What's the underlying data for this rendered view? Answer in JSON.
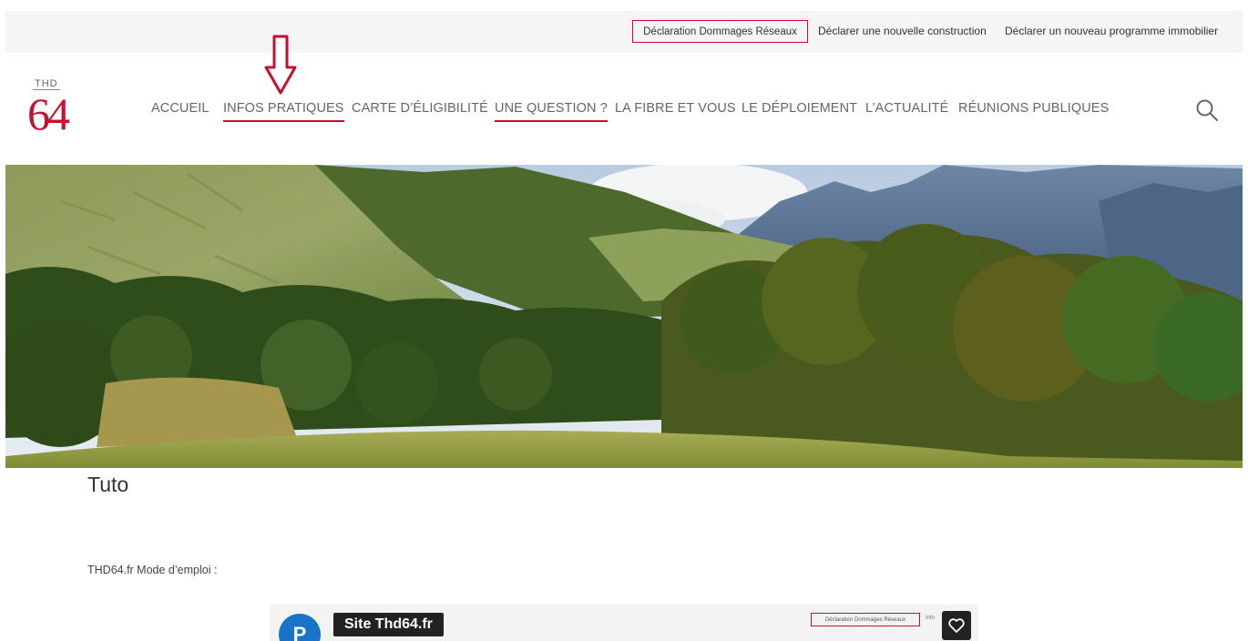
{
  "top_links": {
    "declaration": "Déclaration Dommages Réseaux",
    "construction": "Déclarer une nouvelle construction",
    "programme": "Déclarer un nouveau programme immobilier"
  },
  "logo": {
    "small": "THD",
    "big": "64"
  },
  "nav": {
    "items": [
      {
        "label": "ACCUEIL"
      },
      {
        "label": "INFOS PRATIQUES",
        "highlighted": true
      },
      {
        "label": "CARTE D’ÉLIGIBILITÉ"
      },
      {
        "label": "UNE QUESTION ?",
        "highlighted": true
      },
      {
        "label": "LA FIBRE ET VOUS"
      },
      {
        "label": "LE DÉPLOIEMENT"
      },
      {
        "label": "L’ACTUALITÉ"
      },
      {
        "label": "RÉUNIONS PUBLIQUES"
      }
    ],
    "search_icon": "search-icon"
  },
  "hero": {
    "image": "mountain-landscape"
  },
  "page": {
    "title": "Tuto",
    "intro": "THD64.fr Mode d’emploi :"
  },
  "video": {
    "avatar_letter": "P",
    "title": "Site Thd64.fr",
    "mini_box": "Déclaration Dommages Réseaux",
    "mini_link": "Info"
  },
  "colors": {
    "accent": "#c8102e",
    "topbar": "#f5f5f5"
  }
}
